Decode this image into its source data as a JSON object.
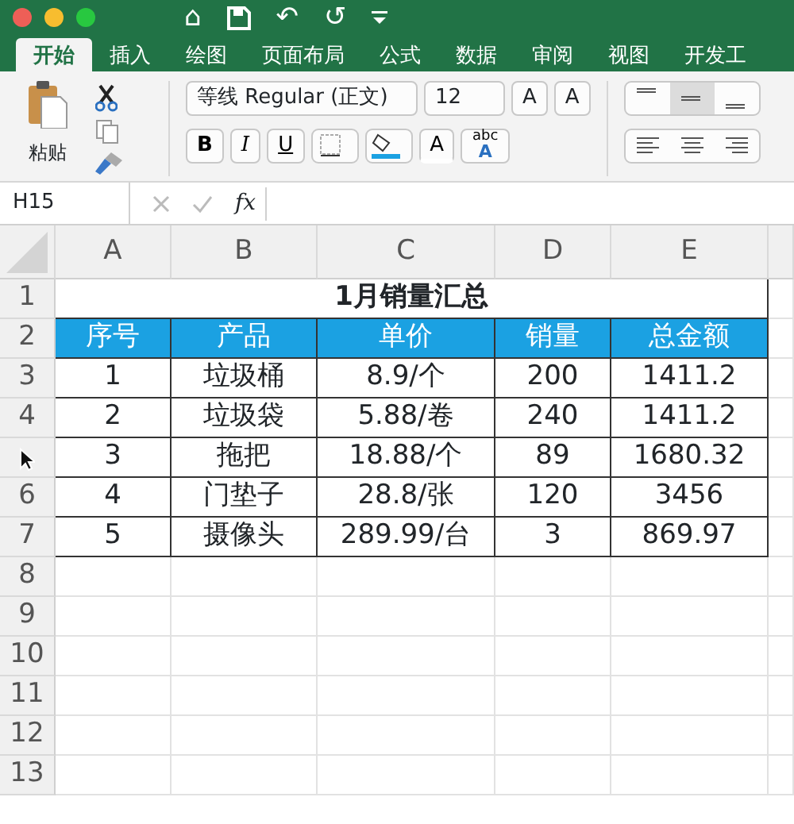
{
  "quick_access": [
    "⌂",
    "↶",
    "↺"
  ],
  "tabs": [
    {
      "label": "开始",
      "selected": true
    },
    {
      "label": "插入",
      "selected": false
    },
    {
      "label": "绘图",
      "selected": false
    },
    {
      "label": "页面布局",
      "selected": false
    },
    {
      "label": "公式",
      "selected": false
    },
    {
      "label": "数据",
      "selected": false
    },
    {
      "label": "审阅",
      "selected": false
    },
    {
      "label": "视图",
      "selected": false
    },
    {
      "label": "开发工",
      "selected": false
    }
  ],
  "ribbon": {
    "paste_label": "粘贴",
    "font_name": "等线 Regular (正文)",
    "font_size": "12",
    "bold": "B",
    "italic": "I",
    "underline": "U",
    "font_color_letter": "A",
    "grow": "A",
    "shrink": "A",
    "abc": "abc",
    "abc_letter": "A"
  },
  "formula_bar": {
    "name_box": "H15",
    "fx": "fx"
  },
  "sheet": {
    "columns": [
      "A",
      "B",
      "C",
      "D",
      "E"
    ],
    "title": "1月销量汇总",
    "header": [
      "序号",
      "产品",
      "单价",
      "销量",
      "总金额"
    ],
    "title_row_number": "1",
    "header_row_number": "2",
    "rows": [
      {
        "row_number": "3",
        "cells": [
          "1",
          "垃圾桶",
          "8.9/个",
          "200",
          "1411.2"
        ]
      },
      {
        "row_number": "4",
        "cells": [
          "2",
          "垃圾袋",
          "5.88/卷",
          "240",
          "1411.2"
        ]
      },
      {
        "cells": [
          "3",
          "拖把",
          "18.88/个",
          "89",
          "1680.32"
        ]
      },
      {
        "row_number": "6",
        "cells": [
          "4",
          "门垫子",
          "28.8/张",
          "120",
          "3456"
        ]
      },
      {
        "row_number": "7",
        "cells": [
          "5",
          "摄像头",
          "289.99/台",
          "3",
          "869.97"
        ]
      }
    ],
    "empty_rows": [
      "8",
      "9",
      "10",
      "11",
      "12",
      "13"
    ]
  }
}
